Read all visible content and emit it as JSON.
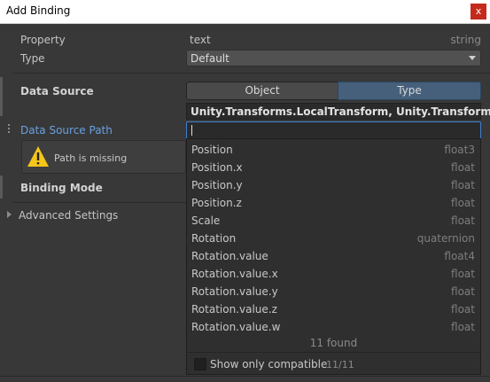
{
  "window": {
    "title": "Add Binding",
    "close_glyph": "x"
  },
  "property": {
    "label": "Property",
    "value": "text",
    "type": "string"
  },
  "type_row": {
    "label": "Type",
    "selected": "Default"
  },
  "data_source": {
    "label": "Data Source",
    "tabs": [
      "Object",
      "Type"
    ],
    "active_tab": "Type",
    "type_value": "Unity.Transforms.LocalTransform, Unity.Transforms"
  },
  "data_source_path": {
    "label": "Data Source Path",
    "value": "",
    "warning": "Path is missing"
  },
  "binding_mode": {
    "label": "Binding Mode"
  },
  "advanced": {
    "label": "Advanced Settings"
  },
  "completion": {
    "items": [
      {
        "name": "Position",
        "type": "float3"
      },
      {
        "name": "Position.x",
        "type": "float"
      },
      {
        "name": "Position.y",
        "type": "float"
      },
      {
        "name": "Position.z",
        "type": "float"
      },
      {
        "name": "Scale",
        "type": "float"
      },
      {
        "name": "Rotation",
        "type": "quaternion"
      },
      {
        "name": "Rotation.value",
        "type": "float4"
      },
      {
        "name": "Rotation.value.x",
        "type": "float"
      },
      {
        "name": "Rotation.value.y",
        "type": "float"
      },
      {
        "name": "Rotation.value.z",
        "type": "float"
      },
      {
        "name": "Rotation.value.w",
        "type": "float"
      }
    ],
    "found_text": "11 found",
    "show_only_compatible_label": "Show only compatible",
    "show_only_compatible_checked": false,
    "compatible_count": "11/11"
  },
  "colors": {
    "accent": "#3d7fcf",
    "active_tab": "#46607c",
    "path_label": "#6aa0e0",
    "warning": "#f5c518"
  }
}
